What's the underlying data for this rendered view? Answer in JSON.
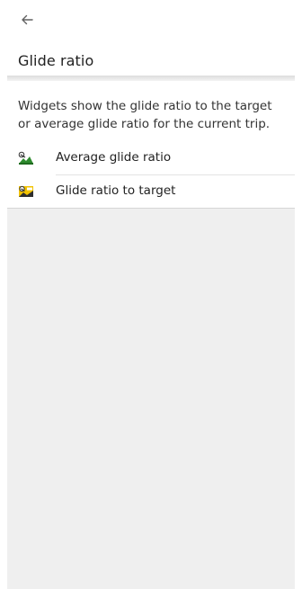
{
  "header": {
    "back_icon": "arrow-left-icon",
    "title": "Glide ratio"
  },
  "card": {
    "description": "Widgets show the glide ratio to the target or average glide ratio for the current trip.",
    "items": [
      {
        "label": "Average glide ratio",
        "icon": "glider-landscape-icon"
      },
      {
        "label": "Glide ratio to target",
        "icon": "glider-target-icon"
      }
    ]
  },
  "colors": {
    "background": "#efefef",
    "card": "#ffffff",
    "icon_green": "#2e8b2e",
    "icon_yellow": "#f2c200"
  }
}
